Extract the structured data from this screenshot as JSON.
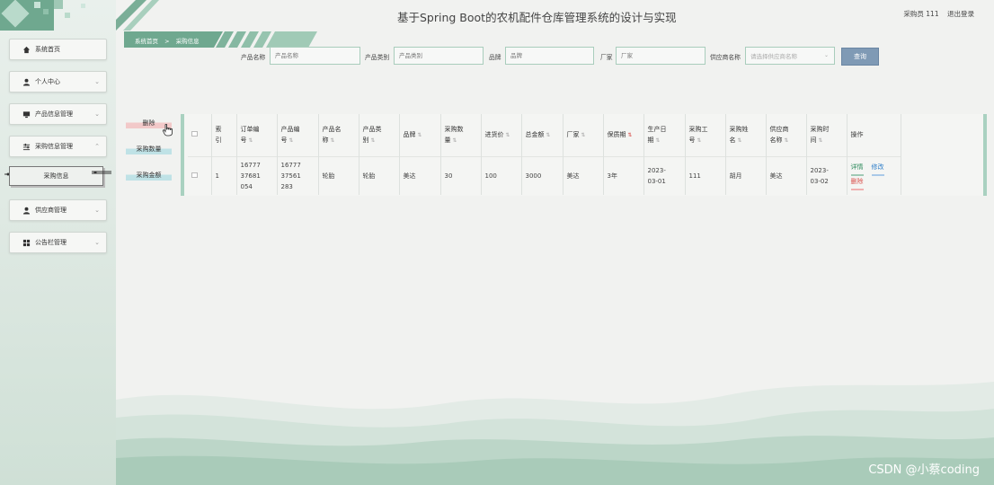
{
  "header": {
    "title": "基于Spring Boot的农机配件仓库管理系统的设计与实现",
    "user": "采购员 111",
    "logout": "退出登录"
  },
  "sidebar": {
    "items": [
      {
        "label": "系统首页",
        "icon": "home-icon"
      },
      {
        "label": "个人中心",
        "icon": "user-icon"
      },
      {
        "label": "产品信息管理",
        "icon": "monitor-icon"
      },
      {
        "label": "采购信息管理",
        "icon": "sliders-icon"
      },
      {
        "label": "供应商管理",
        "icon": "user-icon"
      },
      {
        "label": "公告栏管理",
        "icon": "grid-icon"
      }
    ],
    "sub_active": "采购信息"
  },
  "breadcrumb": {
    "home": "系统首页",
    "sep": ">",
    "current": "采购信息"
  },
  "search": {
    "product_name_label": "产品名称",
    "product_name_placeholder": "产品名称",
    "product_type_label": "产品类别",
    "product_type_placeholder": "产品类别",
    "brand_label": "品牌",
    "brand_placeholder": "品牌",
    "maker_label": "厂家",
    "maker_placeholder": "厂家",
    "supplier_label": "供应商名称",
    "supplier_placeholder": "请选择供应商名称",
    "query_button": "查询"
  },
  "actions": {
    "delete": "删除",
    "qty": "采购数量",
    "amount": "采购金额"
  },
  "table": {
    "headers": [
      {
        "label": "索\n引",
        "sort": false
      },
      {
        "label": "订单编\n号",
        "sort": true
      },
      {
        "label": "产品编\n号",
        "sort": true
      },
      {
        "label": "产品名\n称",
        "sort": true
      },
      {
        "label": "产品类\n别",
        "sort": true
      },
      {
        "label": "品牌",
        "sort": true
      },
      {
        "label": "采购数\n量",
        "sort": true
      },
      {
        "label": "进货价",
        "sort": true
      },
      {
        "label": "总金额",
        "sort": true
      },
      {
        "label": "厂家",
        "sort": true
      },
      {
        "label": "保质期",
        "sort": true
      },
      {
        "label": "生产日\n期",
        "sort": true
      },
      {
        "label": "采购工\n号",
        "sort": true
      },
      {
        "label": "采购姓\n名",
        "sort": true
      },
      {
        "label": "供应商\n名称",
        "sort": true
      },
      {
        "label": "采购时\n间",
        "sort": true
      },
      {
        "label": "操作",
        "sort": false
      }
    ],
    "rows": [
      [
        "1",
        "16777\n37681\n054",
        "16777\n37561\n283",
        "轮胎",
        "轮胎",
        "美达",
        "30",
        "100",
        "3000",
        "美达",
        "3年",
        "2023-\n03-01",
        "111",
        "胡月",
        "美达",
        "2023-\n03-02"
      ]
    ],
    "ops": {
      "detail": "详情",
      "edit": "修改",
      "delete": "删除"
    }
  },
  "watermark": "CSDN @小蔡coding"
}
